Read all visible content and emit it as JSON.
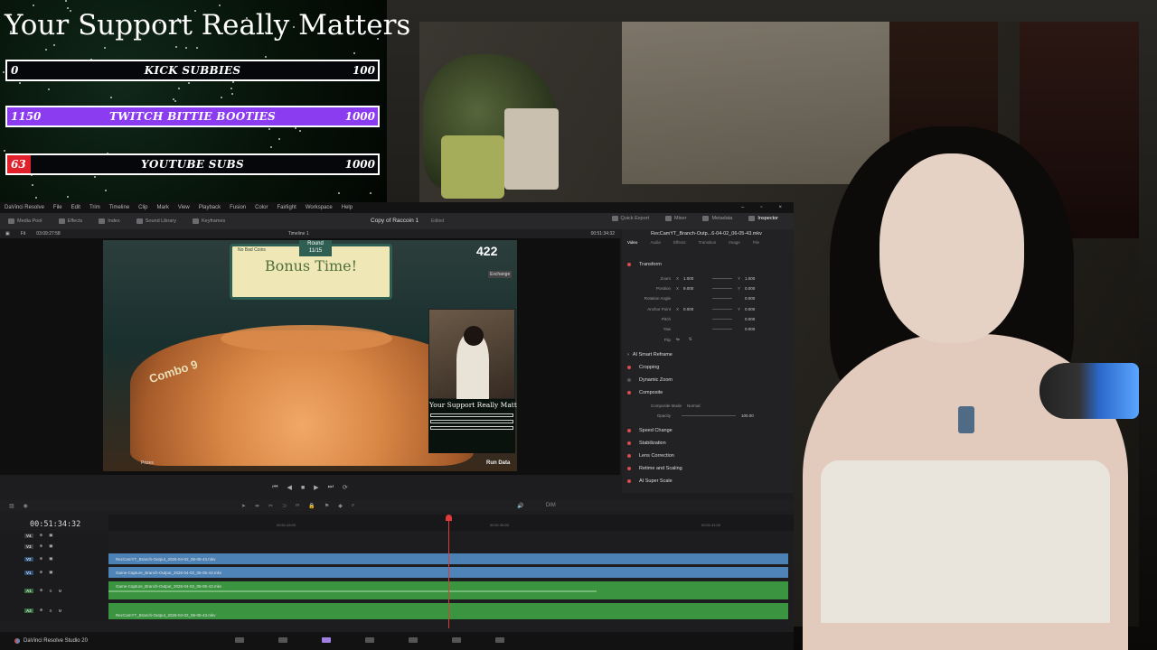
{
  "overlay": {
    "title": "Your Support Really Matters",
    "goals": [
      {
        "name": "KICK SUBBIES",
        "current": "0",
        "target": "100",
        "progress": 0.0,
        "fill_color": "#05070a"
      },
      {
        "name": "TWITCH BITTIE BOOTIES",
        "current": "1150",
        "target": "1000",
        "progress": 1.0,
        "fill_color": "#8c3cf0"
      },
      {
        "name": "YOUTUBE SUBS",
        "current": "63",
        "target": "1000",
        "progress": 0.063,
        "fill_color": "#e0202a"
      }
    ]
  },
  "resolve": {
    "app_menu": [
      "DaVinci Resolve",
      "File",
      "Edit",
      "Trim",
      "Timeline",
      "Clip",
      "Mark",
      "View",
      "Playback",
      "Fusion",
      "Color",
      "Fairlight",
      "Workspace",
      "Help"
    ],
    "toolbar_left": [
      "Media Pool",
      "Effects",
      "Index",
      "Sound Library",
      "Keyframes"
    ],
    "toolbar_right": [
      "Quick Export",
      "Mixer",
      "Metadata",
      "Inspector"
    ],
    "project_title": "Copy of Raccoin 1",
    "project_state": "Edited",
    "viewer": {
      "fit": "Fit",
      "source_tc": "03:09:27:58",
      "timeline_name": "Timeline 1",
      "viewer_tc": "00:51:34:32"
    },
    "game_frame": {
      "no_bad_coins": "No Bad Coins",
      "round_label": "Round",
      "round_value": "11/15",
      "bonus": "Bonus Time!",
      "score": "422",
      "exchange": "Exchange",
      "combo": "Combo 9",
      "prizes": "Prizes",
      "run_data": "Run Data",
      "mini_title": "Your Support Really Matters"
    },
    "inspector": {
      "clip_name": "RecCamYT_Branch-Outp...6-04-02_06-05-43.mkv",
      "tabs": [
        "Video",
        "Audio",
        "Effects",
        "Transition",
        "Image",
        "File"
      ],
      "transform_label": "Transform",
      "rows": [
        {
          "label": "Zoom",
          "x": "1.000",
          "y": "1.000"
        },
        {
          "label": "Position",
          "x": "9.000",
          "y": "0.000"
        },
        {
          "label": "Rotation Angle",
          "x": "",
          "y": "0.000"
        },
        {
          "label": "Anchor Point",
          "x": "0.000",
          "y": "0.000"
        },
        {
          "label": "Pitch",
          "x": "",
          "y": "0.000"
        },
        {
          "label": "Yaw",
          "x": "",
          "y": "0.000"
        },
        {
          "label": "Flip",
          "x": "",
          "y": ""
        }
      ],
      "sections": [
        "AI Smart Reframe",
        "Cropping",
        "Dynamic Zoom",
        "Composite"
      ],
      "composite_mode_label": "Composite Mode",
      "composite_mode": "Normal",
      "opacity_label": "Opacity",
      "opacity": "100.00",
      "more_sections": [
        "Speed Change",
        "Stabilization",
        "Lens Correction",
        "Retime and Scaling",
        "AI Super Scale"
      ]
    },
    "timeline": {
      "timecode": "00:51:34:32",
      "ruler": [
        "00:51:28:00",
        "00:51:36:00",
        "00:51:44:00"
      ],
      "tracks": [
        "V4",
        "V3",
        "V2",
        "V1",
        "A1",
        "A2"
      ],
      "clips": {
        "v2": "RecCamYT_Branch-Output_2026-04-02_06-05-43.mkv",
        "v1": "Game-Capture_Branch-Output_2026-04-02_06-05-43.mkv",
        "a1": "Game-Capture_Branch-Output_2026-04-02_06-05-43.mkv",
        "a2": "RecCamYT_Branch-Output_2026-04-02_06-05-43.mkv"
      },
      "audio_level": "DIM"
    },
    "footer_app": "DaVinci Resolve Studio 20"
  }
}
